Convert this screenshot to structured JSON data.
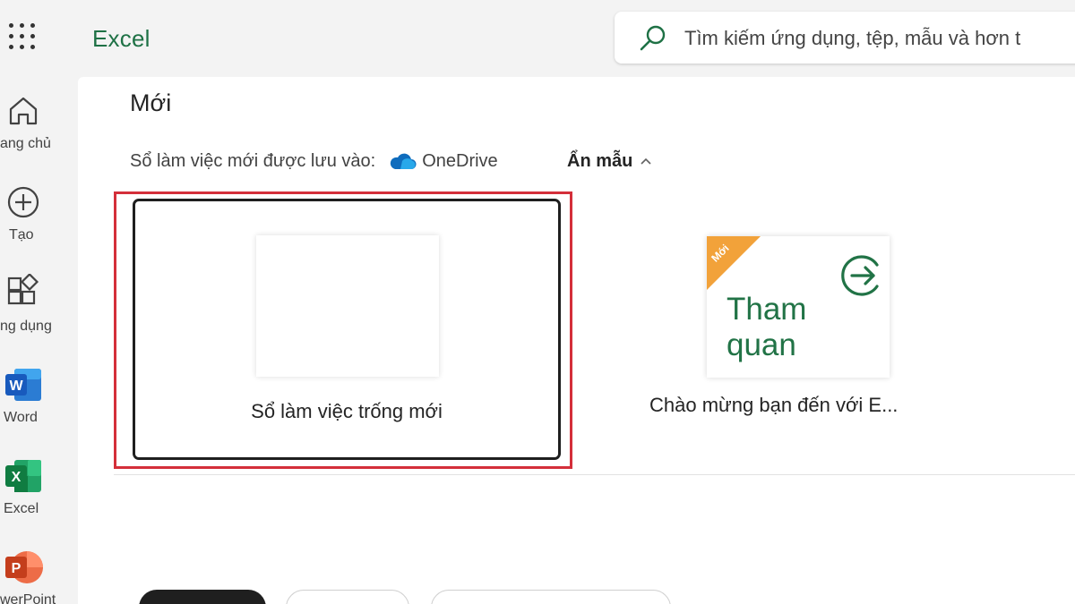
{
  "app": {
    "title": "Excel"
  },
  "search": {
    "placeholder": "Tìm kiếm ứng dụng, tệp, mẫu và hơn t"
  },
  "rail": {
    "items": [
      {
        "id": "home",
        "label": "ang chủ"
      },
      {
        "id": "create",
        "label": "Tạo"
      },
      {
        "id": "apps",
        "label": "ng dụng"
      },
      {
        "id": "word",
        "label": "Word",
        "color": "#185abd"
      },
      {
        "id": "excel",
        "label": "Excel",
        "color": "#107c41"
      },
      {
        "id": "powerpoint",
        "label": "werPoint",
        "color": "#c43e1c"
      }
    ]
  },
  "main": {
    "section_title": "Mới",
    "save_prefix": "Sổ làm việc mới được lưu vào:",
    "save_location": "OneDrive",
    "hide_templates": "Ẩn mẫu",
    "templates": [
      {
        "id": "blank",
        "label": "Sổ làm việc trống mới"
      },
      {
        "id": "tour",
        "badge": "Mới",
        "thumb_line1": "Tham",
        "thumb_line2": "quan",
        "label": "Chào mừng bạn đến với E..."
      }
    ]
  },
  "colors": {
    "accent": "#217346",
    "highlight": "#d42f3a",
    "badge": "#f2a23a",
    "onedrive": "#0f6cbd"
  }
}
